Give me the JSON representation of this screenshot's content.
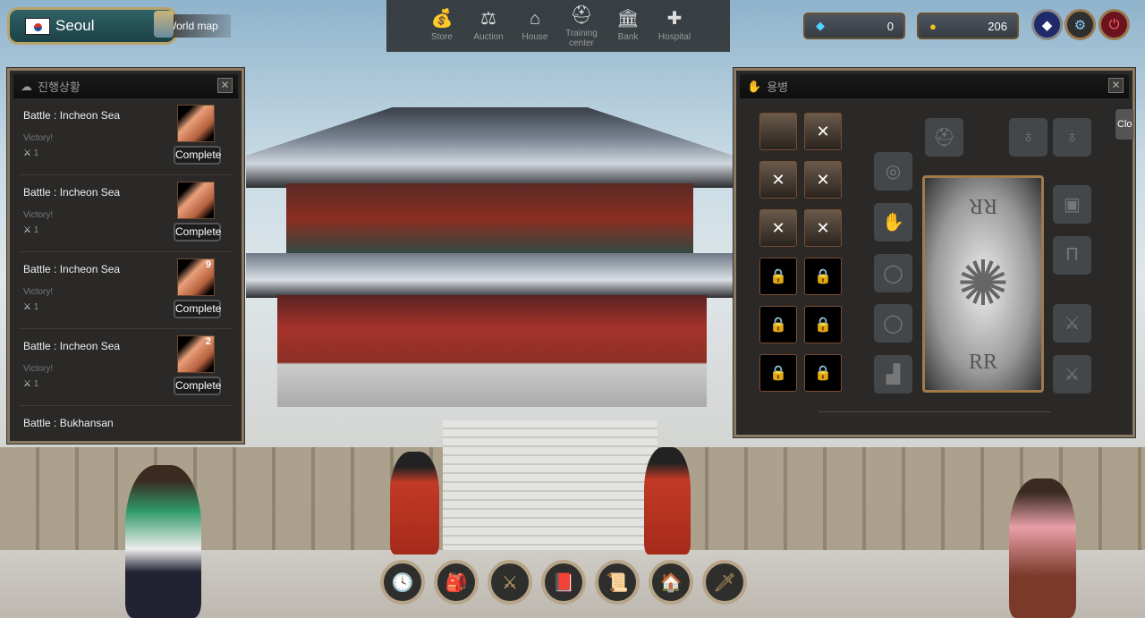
{
  "location": {
    "name": "Seoul",
    "flag": "south-korea-flag",
    "world_map_label": "World map"
  },
  "top_nav": [
    {
      "label": "Store",
      "icon": "money-bag-icon",
      "glyph": "💰"
    },
    {
      "label": "Auction",
      "icon": "gavel-icon",
      "glyph": "⚖"
    },
    {
      "label": "House",
      "icon": "house-icon",
      "glyph": "⌂"
    },
    {
      "label": "Training center",
      "icon": "knight-helmet-icon",
      "glyph": "⛑"
    },
    {
      "label": "Bank",
      "icon": "bank-icon",
      "glyph": "🏛"
    },
    {
      "label": "Hospital",
      "icon": "shield-cross-icon",
      "glyph": "✚"
    }
  ],
  "currency": {
    "diamonds": "0",
    "gold": "206"
  },
  "progress_panel": {
    "title": "진행상황",
    "complete_label": "Complete",
    "rows": [
      {
        "title": "Battle : Incheon Sea",
        "status": "Victory!",
        "count": "1",
        "item_qty": ""
      },
      {
        "title": "Battle : Incheon Sea",
        "status": "Victory!",
        "count": "1",
        "item_qty": ""
      },
      {
        "title": "Battle : Incheon Sea",
        "status": "Victory!",
        "count": "1",
        "item_qty": "9"
      },
      {
        "title": "Battle : Incheon Sea",
        "status": "Victory!",
        "count": "1",
        "item_qty": "2"
      },
      {
        "title": "Battle : Bukhansan",
        "status": "",
        "count": "",
        "item_qty": ""
      }
    ]
  },
  "mercenary_panel": {
    "title": "용병",
    "close_tab_label": "Clo",
    "card_logo": "RR"
  },
  "colors": {
    "panel_bg": "#2a2928",
    "panel_border": "#8a7a62",
    "location_bg": "#2f6166",
    "diamond_btn": "#1e2a6a",
    "settings_btn": "#2f2f2f",
    "power_btn": "#6a1420"
  }
}
